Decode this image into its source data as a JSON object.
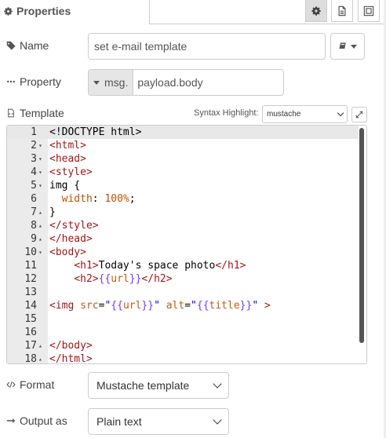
{
  "header": {
    "title": "Properties",
    "tabs": [
      {
        "icon": "gear-icon",
        "active": true
      },
      {
        "icon": "document-icon",
        "active": false
      },
      {
        "icon": "frame-icon",
        "active": false
      }
    ]
  },
  "name": {
    "label": "Name",
    "value": "set e-mail template"
  },
  "property": {
    "label": "Property",
    "prefix": "msg.",
    "value": "payload.body"
  },
  "template": {
    "label": "Template",
    "syntax_label": "Syntax Highlight:",
    "syntax_value": "mustache",
    "lines": [
      {
        "n": "1",
        "fold": "",
        "html": "<span>&lt;!DOCTYPE html&gt;</span>"
      },
      {
        "n": "2",
        "fold": "▾",
        "html": "<span class='tag'>&lt;html&gt;</span>"
      },
      {
        "n": "3",
        "fold": "▾",
        "html": "<span class='tag'>&lt;head&gt;</span>"
      },
      {
        "n": "4",
        "fold": "▾",
        "html": "<span class='tag'>&lt;style&gt;</span>"
      },
      {
        "n": "5",
        "fold": "▾",
        "html": "img {"
      },
      {
        "n": "6",
        "fold": "",
        "html": "  <span class='prop'>width</span>: <span class='num'>100</span><span class='num'>%</span>;"
      },
      {
        "n": "7",
        "fold": "▴",
        "html": "}"
      },
      {
        "n": "8",
        "fold": "▴",
        "html": "<span class='tag'>&lt;/style&gt;</span>"
      },
      {
        "n": "9",
        "fold": "▴",
        "html": "<span class='tag'>&lt;/head&gt;</span>"
      },
      {
        "n": "10",
        "fold": "▾",
        "html": "<span class='tag'>&lt;body&gt;</span>"
      },
      {
        "n": "11",
        "fold": "",
        "html": "    <span class='tag'>&lt;h1&gt;</span>Today's space photo<span class='tag'>&lt;/h1&gt;</span>"
      },
      {
        "n": "12",
        "fold": "",
        "html": "    <span class='tag'>&lt;h2&gt;</span><span class='mus'>{{</span><span class='attr'>url</span><span class='mus'>}}</span><span class='tag'>&lt;/h2&gt;</span>"
      },
      {
        "n": "13",
        "fold": "",
        "html": ""
      },
      {
        "n": "14",
        "fold": "",
        "html": "<span class='tag'>&lt;img</span> <span class='attr'>src</span>=<span class='str'>\"</span><span class='mus'>{{</span><span class='attr'>url</span><span class='mus'>}}</span><span class='str'>\"</span> <span class='attr'>alt</span>=<span class='str'>\"</span><span class='mus'>{{</span><span class='attr'>title</span><span class='mus'>}}</span><span class='str'>\"</span> <span class='tag'>&gt;</span>"
      },
      {
        "n": "15",
        "fold": "",
        "html": ""
      },
      {
        "n": "16",
        "fold": "",
        "html": ""
      },
      {
        "n": "17",
        "fold": "▴",
        "html": "<span class='tag'>&lt;/body&gt;</span>"
      },
      {
        "n": "18",
        "fold": "▴",
        "html": "<span class='tag'>&lt;/html&gt;</span>"
      }
    ]
  },
  "format": {
    "label": "Format",
    "value": "Mustache template"
  },
  "output": {
    "label": "Output as",
    "value": "Plain text"
  }
}
